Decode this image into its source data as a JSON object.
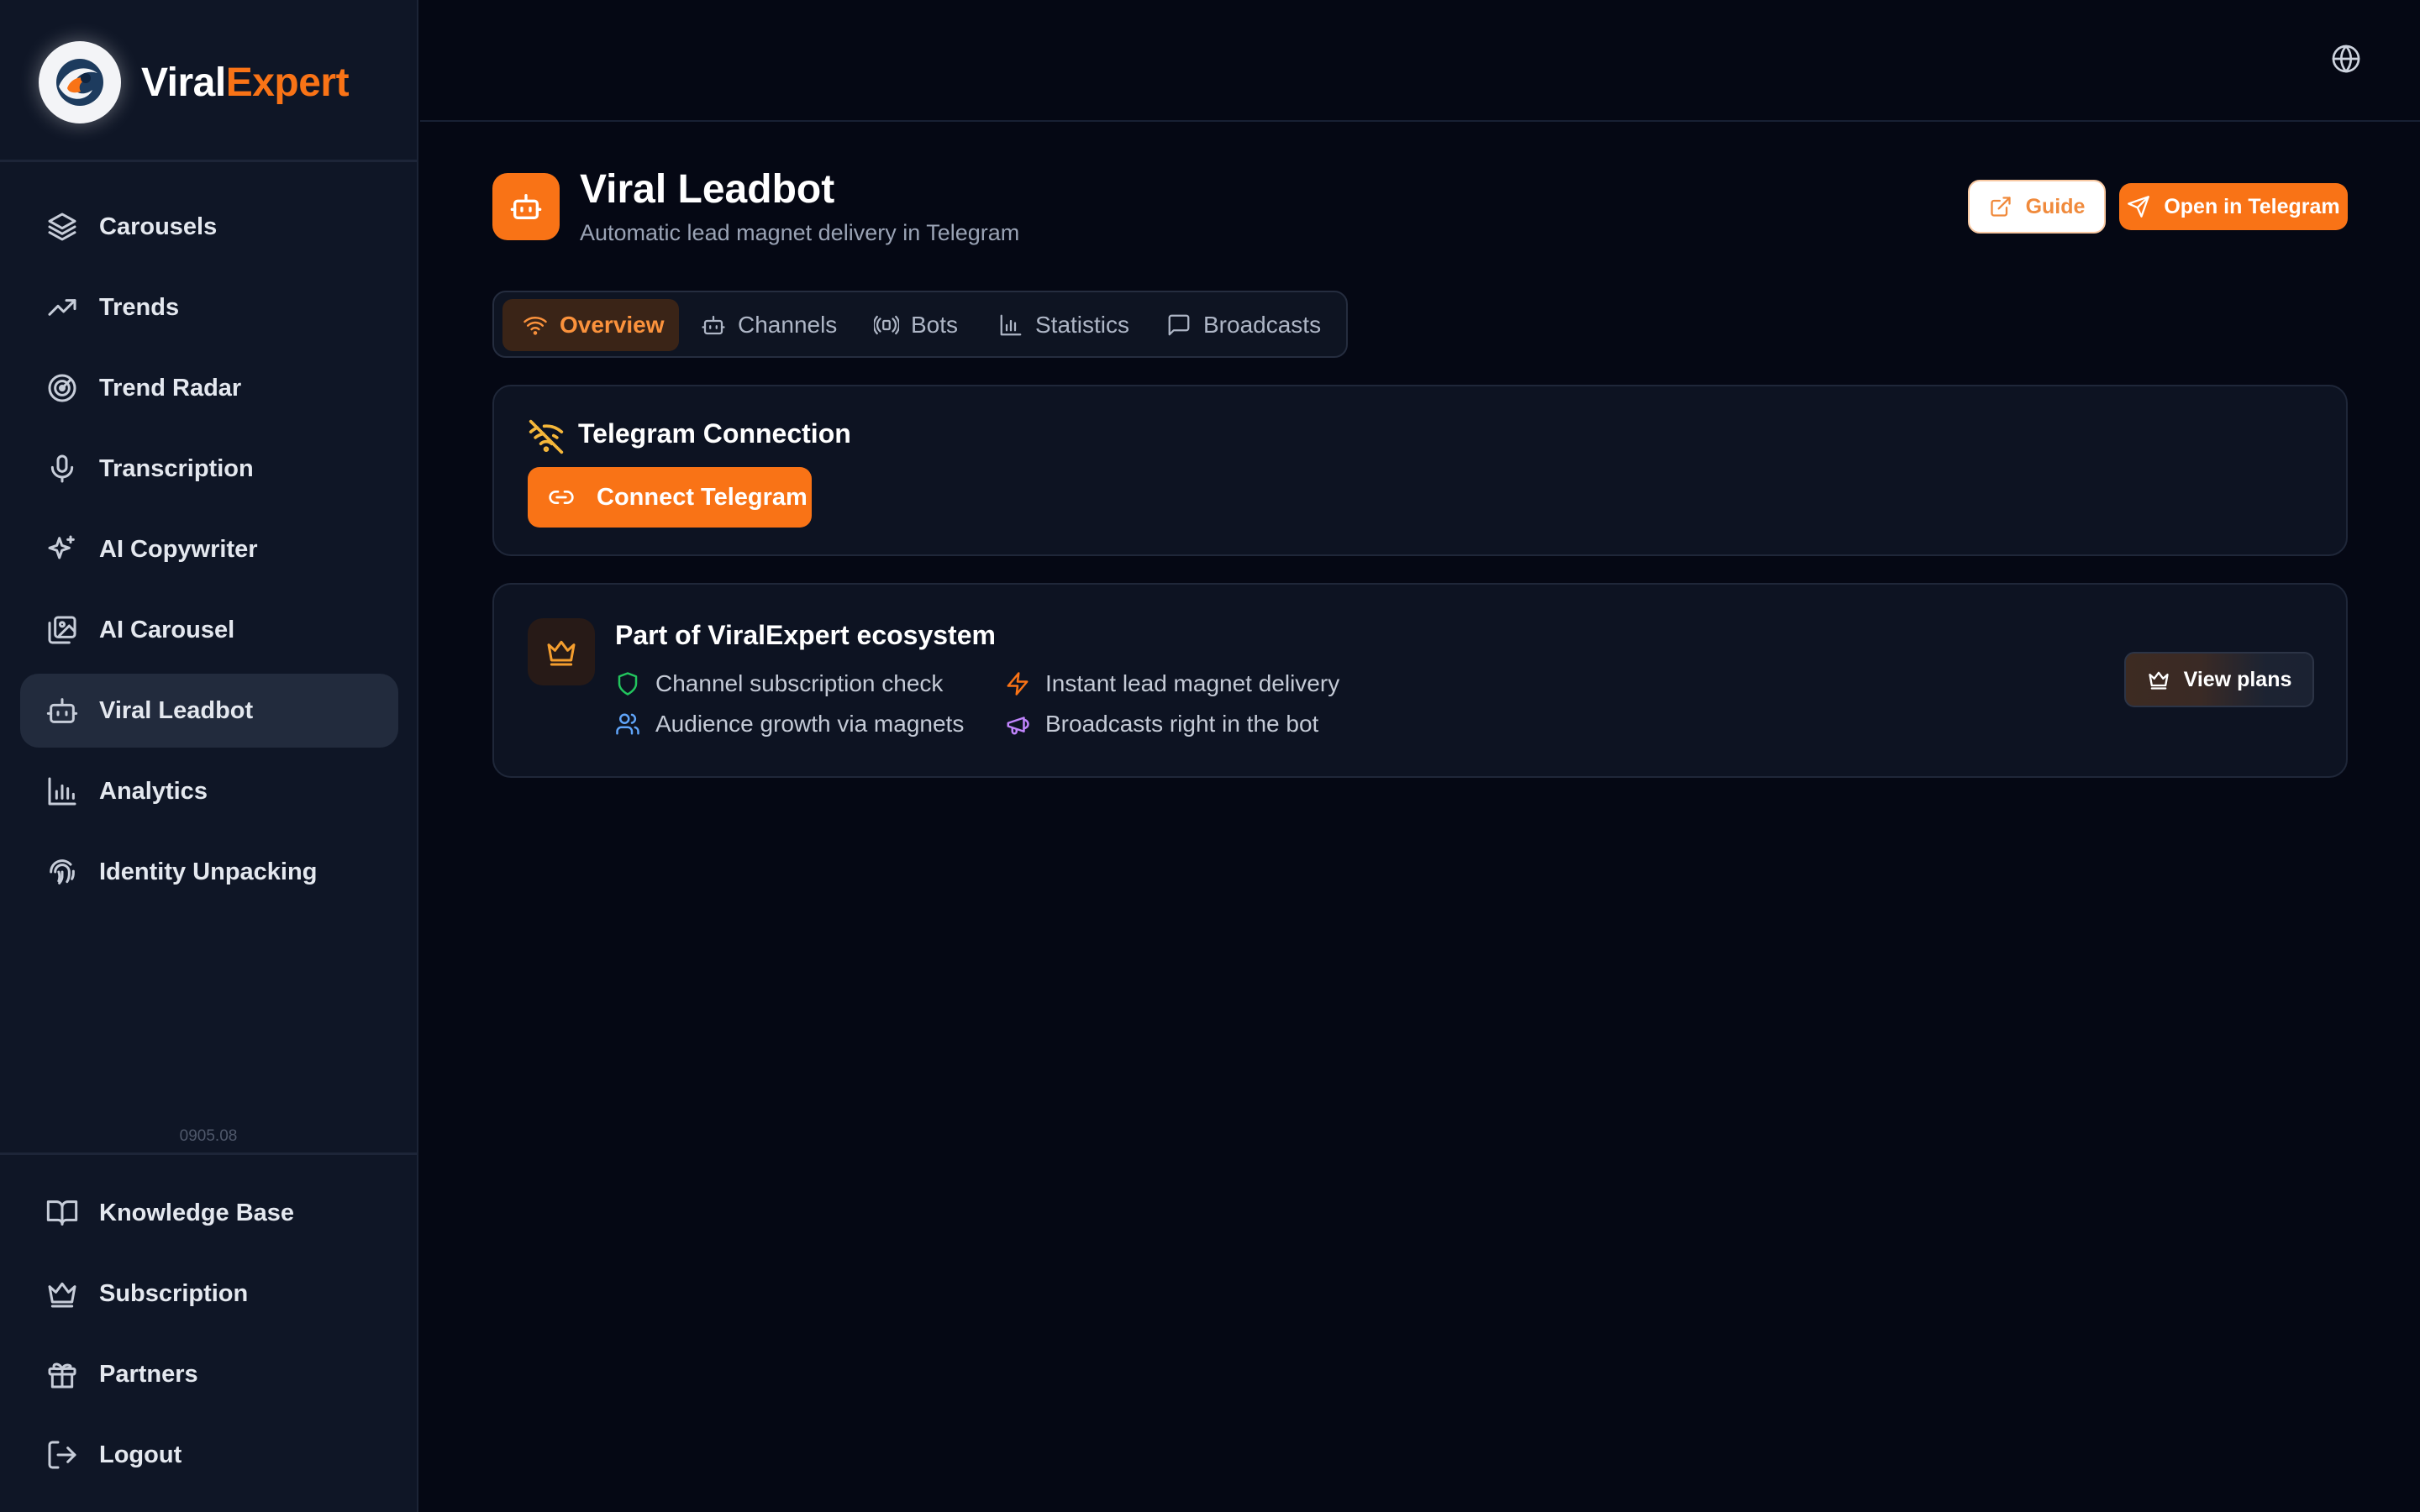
{
  "brand": {
    "name_part1": "Viral",
    "name_part2": "Expert"
  },
  "sidebar": {
    "items": [
      {
        "label": "Carousels",
        "icon": "layers-icon"
      },
      {
        "label": "Trends",
        "icon": "trending-up-icon"
      },
      {
        "label": "Trend Radar",
        "icon": "radar-icon"
      },
      {
        "label": "Transcription",
        "icon": "microphone-icon"
      },
      {
        "label": "AI Copywriter",
        "icon": "sparkles-icon"
      },
      {
        "label": "AI Carousel",
        "icon": "images-icon"
      },
      {
        "label": "Viral Leadbot",
        "icon": "bot-icon",
        "active": true
      },
      {
        "label": "Analytics",
        "icon": "bar-chart-icon"
      },
      {
        "label": "Identity Unpacking",
        "icon": "fingerprint-icon"
      }
    ],
    "version": "0905.08",
    "bottom_items": [
      {
        "label": "Knowledge Base",
        "icon": "book-icon"
      },
      {
        "label": "Subscription",
        "icon": "crown-icon"
      },
      {
        "label": "Partners",
        "icon": "gift-icon"
      },
      {
        "label": "Logout",
        "icon": "logout-icon"
      }
    ]
  },
  "header": {
    "title": "Viral Leadbot",
    "subtitle": "Automatic lead magnet delivery in Telegram",
    "guide_label": "Guide",
    "open_label": "Open in Telegram"
  },
  "tabs": [
    {
      "label": "Overview",
      "icon": "wifi-icon",
      "active": true
    },
    {
      "label": "Channels",
      "icon": "bot-icon"
    },
    {
      "label": "Bots",
      "icon": "broadcast-icon"
    },
    {
      "label": "Statistics",
      "icon": "bar-chart-icon"
    },
    {
      "label": "Broadcasts",
      "icon": "message-icon"
    }
  ],
  "connection": {
    "title": "Telegram Connection",
    "icon": "wifi-off-icon",
    "button_label": "Connect Telegram"
  },
  "ecosystem": {
    "title": "Part of ViralExpert ecosystem",
    "features": [
      {
        "label": "Channel subscription check",
        "icon": "shield-icon",
        "color": "#22c55e"
      },
      {
        "label": "Instant lead magnet delivery",
        "icon": "zap-icon",
        "color": "#f97316"
      },
      {
        "label": "Audience growth via magnets",
        "icon": "users-icon",
        "color": "#60a5fa"
      },
      {
        "label": "Broadcasts right in the bot",
        "icon": "megaphone-icon",
        "color": "#c084fc"
      }
    ],
    "button_label": "View plans"
  },
  "colors": {
    "accent": "#f97316",
    "background": "#050814",
    "sidebar": "#0f1626"
  }
}
